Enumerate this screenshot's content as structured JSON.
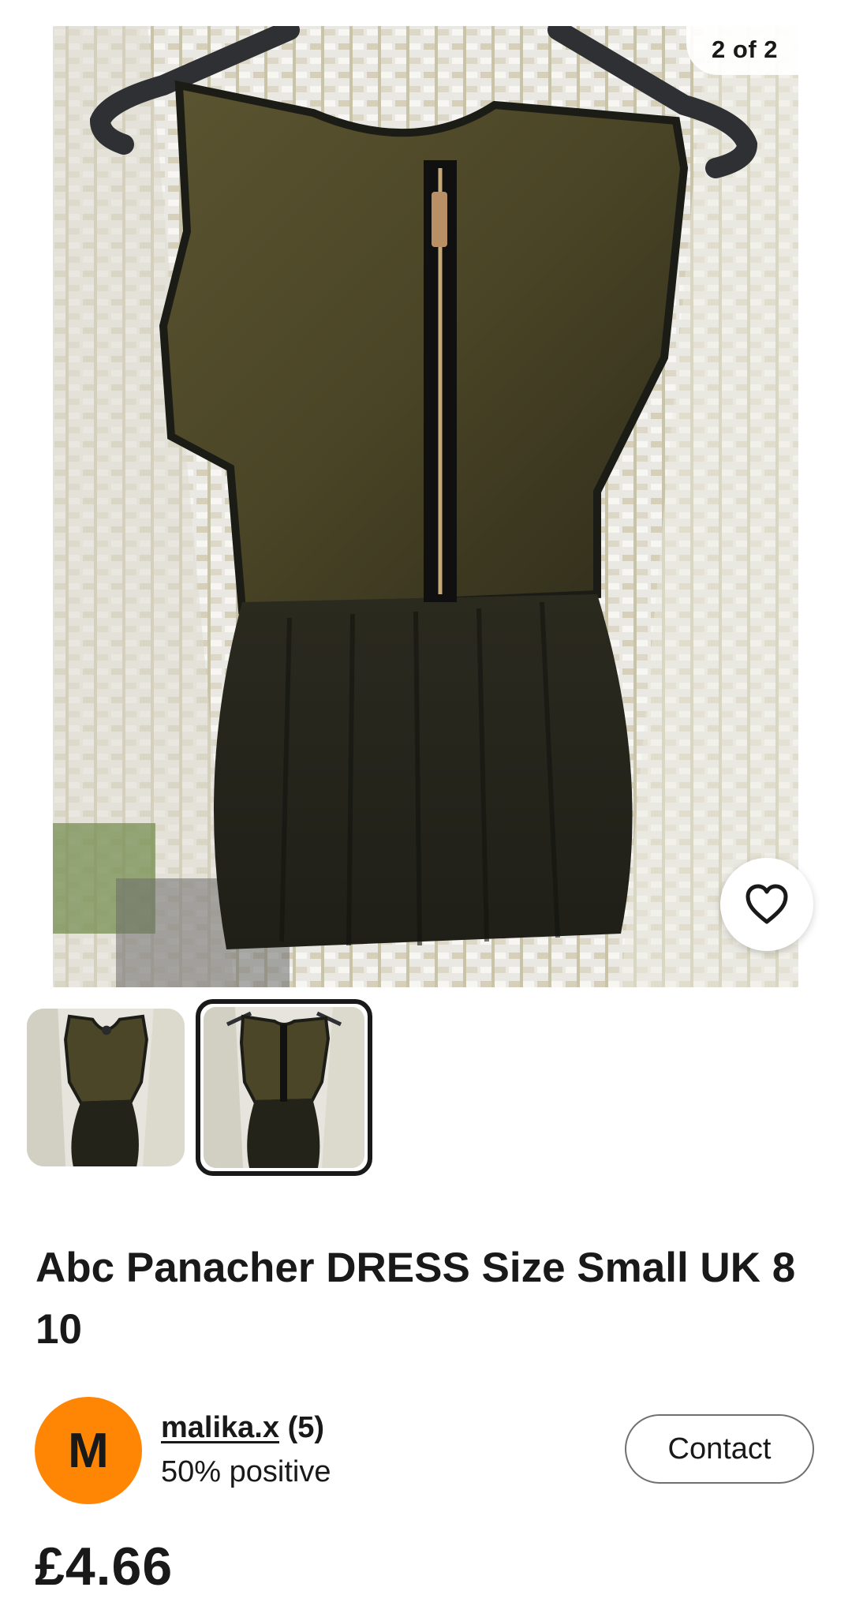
{
  "gallery": {
    "counter": "2 of 2",
    "icons": {
      "favorite": "heart-outline-icon"
    },
    "thumbnails": [
      {
        "name": "dress-front-photo",
        "selected": false
      },
      {
        "name": "dress-back-photo",
        "selected": true
      }
    ]
  },
  "listing": {
    "title": "Abc Panacher DRESS Size Small UK 8 10",
    "price": "£4.66"
  },
  "seller": {
    "avatar_letter": "M",
    "avatar_color": "#ff8605",
    "username": "malika.x",
    "feedback_count": "(5)",
    "positive": "50% positive",
    "contact_label": "Contact"
  }
}
